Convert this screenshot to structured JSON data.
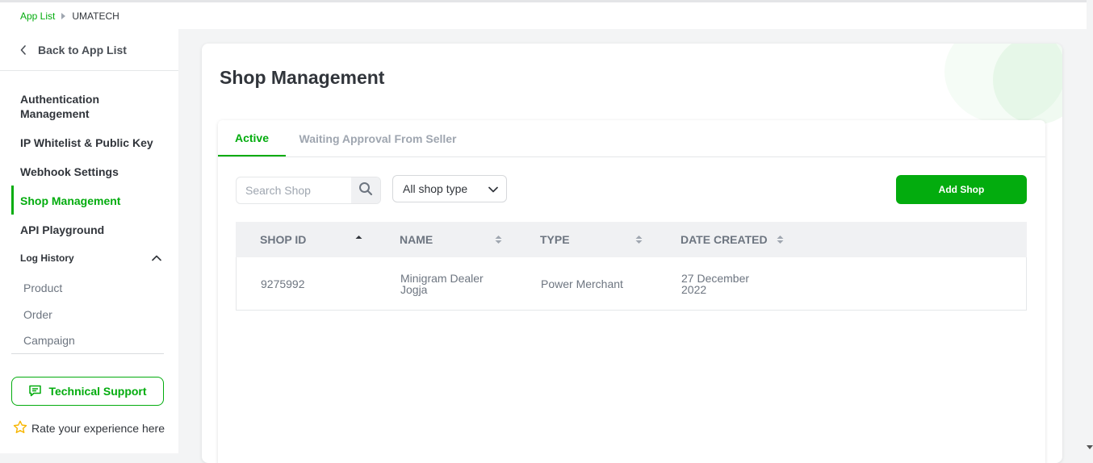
{
  "breadcrumb": {
    "parent": "App List",
    "current": "UMATECH"
  },
  "sidebar": {
    "back_label": "Back to App List",
    "items": [
      {
        "label": "Authentication Management"
      },
      {
        "label": "IP Whitelist & Public Key"
      },
      {
        "label": "Webhook Settings"
      },
      {
        "label": "Shop Management"
      },
      {
        "label": "API Playground"
      }
    ],
    "log_history": {
      "label": "Log History",
      "sub_items": [
        {
          "label": "Product"
        },
        {
          "label": "Order"
        },
        {
          "label": "Campaign"
        }
      ]
    },
    "support_label": "Technical Support",
    "rate_label": "Rate your experience here"
  },
  "main": {
    "title": "Shop Management",
    "tabs": [
      {
        "label": "Active"
      },
      {
        "label": "Waiting Approval From Seller"
      }
    ],
    "search_placeholder": "Search Shop",
    "filter_value": "All shop type",
    "add_label": "Add Shop",
    "table": {
      "headers": [
        "SHOP ID",
        "NAME",
        "TYPE",
        "DATE CREATED"
      ],
      "rows": [
        {
          "shop_id": "9275992",
          "name": "Minigram Dealer Jogja",
          "type": "Power Merchant",
          "date": "27 December 2022"
        }
      ]
    }
  },
  "colors": {
    "accent": "#03ac0e",
    "text": "#31353b",
    "muted": "#6d7580"
  }
}
